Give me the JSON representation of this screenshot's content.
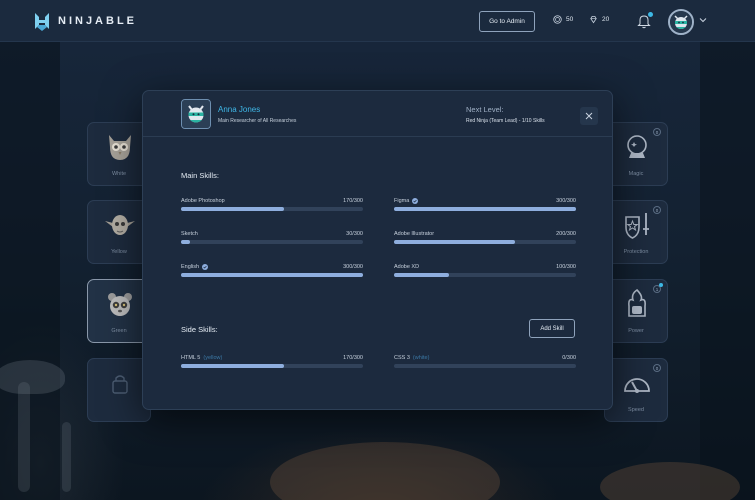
{
  "app": {
    "name": "NINJABLE"
  },
  "topbar": {
    "admin_button": "Go to Admin",
    "coins": "50",
    "gems": "20"
  },
  "left_cards": [
    {
      "label": "White",
      "icon": "owl-icon"
    },
    {
      "label": "Yellow",
      "icon": "goblin-icon"
    },
    {
      "label": "Green",
      "icon": "lemur-icon"
    },
    {
      "label": "",
      "icon": "locked-bag-icon"
    }
  ],
  "right_cards": [
    {
      "label": "Magic",
      "icon": "crystal-ball-icon",
      "badge": "0"
    },
    {
      "label": "Protection",
      "icon": "shield-sword-icon",
      "badge": "0"
    },
    {
      "label": "Power",
      "icon": "fire-fist-icon",
      "badge": "1"
    },
    {
      "label": "Speed",
      "icon": "speedometer-icon",
      "badge": "0"
    }
  ],
  "modal": {
    "name": "Anna Jones",
    "subtitle": "Main Researcher of All Researches",
    "next_level_label": "Next Level:",
    "next_level_value": "Red Ninja (Team Lead)  -  1/10 Skills",
    "main_skills_title": "Main Skills:",
    "side_skills_title": "Side Skills:",
    "add_skill_label": "Add Skill",
    "main_skills": [
      {
        "name": "Adobe Photoshop",
        "value": "170/300",
        "progress": 0.567,
        "verified": false
      },
      {
        "name": "Figma",
        "value": "300/300",
        "progress": 1.0,
        "verified": true
      },
      {
        "name": "Sketch",
        "value": "30/300",
        "progress": 0.05,
        "verified": false
      },
      {
        "name": "Adobe Illustrator",
        "value": "200/300",
        "progress": 0.667,
        "verified": false
      },
      {
        "name": "English",
        "value": "300/300",
        "progress": 1.0,
        "verified": true
      },
      {
        "name": "Adobe XD",
        "value": "100/300",
        "progress": 0.3,
        "verified": false
      }
    ],
    "side_skills": [
      {
        "name": "HTML 5",
        "aux": "(yellow)",
        "value": "170/300",
        "progress": 0.567
      },
      {
        "name": "CSS 3",
        "aux": "(white)",
        "value": "0/300",
        "progress": 0.0
      }
    ]
  },
  "colors": {
    "accent": "#3fb8e8",
    "progress_fill": "#8eaede",
    "progress_track": "#31425a",
    "panel": "#1c2a3e"
  }
}
